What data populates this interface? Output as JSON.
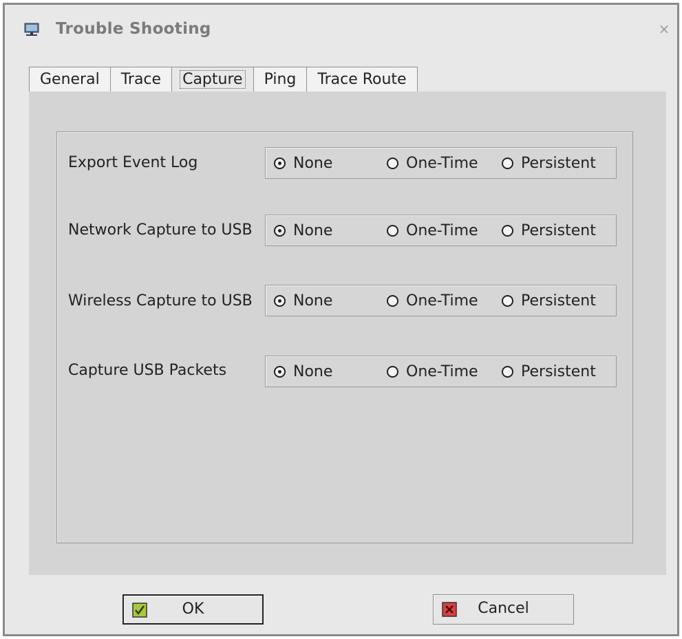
{
  "window": {
    "title": "Trouble Shooting",
    "close_glyph": "×",
    "app_icon": "network-icon"
  },
  "tabs": [
    {
      "label": "General",
      "active": false
    },
    {
      "label": "Trace",
      "active": false
    },
    {
      "label": "Capture",
      "active": true
    },
    {
      "label": "Ping",
      "active": false
    },
    {
      "label": "Trace Route",
      "active": false
    }
  ],
  "capture": {
    "rows": [
      {
        "label": "Export Event Log",
        "mnemonic": "E",
        "selected": "None"
      },
      {
        "label": "Network Capture to USB",
        "mnemonic": "N",
        "selected": "None"
      },
      {
        "label": "Wireless Capture to USB",
        "mnemonic": "W",
        "selected": "None"
      },
      {
        "label": "Capture USB Packets",
        "mnemonic": "U",
        "selected": "None"
      }
    ],
    "options": [
      "None",
      "One-Time",
      "Persistent"
    ]
  },
  "buttons": {
    "ok_label": "OK",
    "ok_icon": "checkmark-icon",
    "cancel_label": "Cancel",
    "cancel_icon": "cancel-x-icon"
  },
  "colors": {
    "ok_icon_fill": "#a9c93c",
    "cancel_icon_fill": "#d94040"
  }
}
